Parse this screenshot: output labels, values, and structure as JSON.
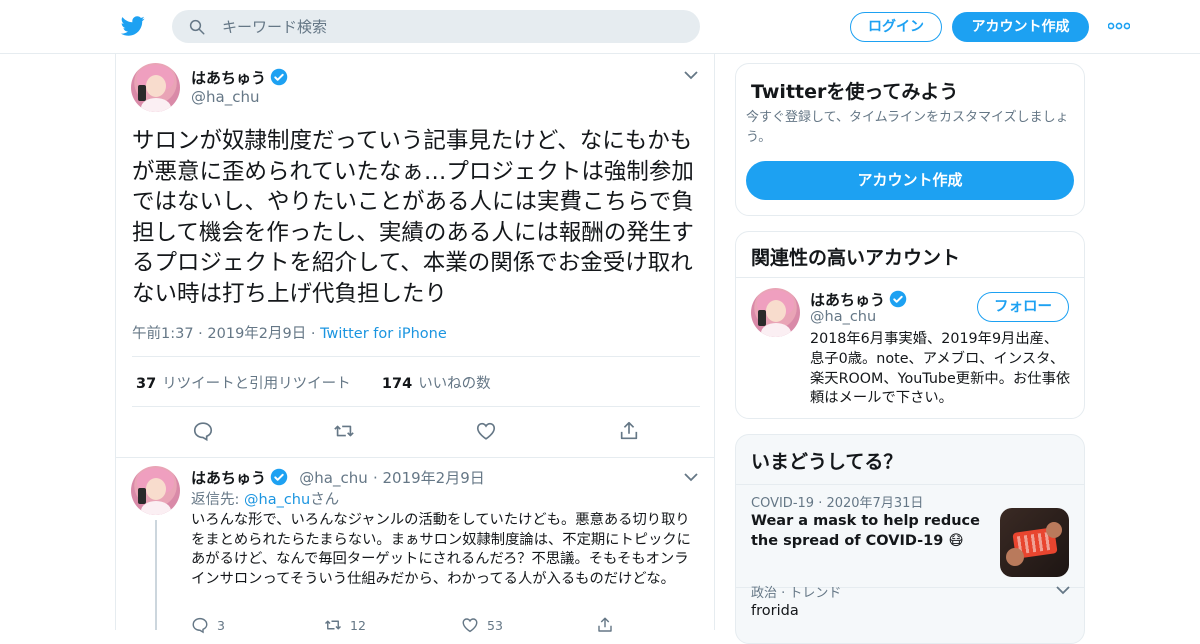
{
  "header": {
    "search_placeholder": "キーワード検索",
    "login_label": "ログイン",
    "signup_label": "アカウント作成"
  },
  "tweet": {
    "name": "はあちゅう",
    "handle": "@ha_chu",
    "text": "サロンが奴隷制度だっていう記事見たけど、なにもかもが悪意に歪められていたなぁ…プロジェクトは強制参加ではないし、やりたいことがある人には実費こちらで負担して機会を作ったし、実績のある人には報酬の発生するプロジェクトを紹介して、本業の関係でお金受け取れない時は打ち上げ代負担したり",
    "time": "午前1:37",
    "date": "2019年2月9日",
    "source": "Twitter for iPhone",
    "retweet_count": "37",
    "retweet_label": "リツイートと引用リツイート",
    "like_count": "174",
    "like_label": "いいねの数"
  },
  "reply": {
    "name": "はあちゅう",
    "handle": "@ha_chu",
    "date": "2019年2月9日",
    "reply_prefix": "返信先: ",
    "reply_to": "@ha_chu",
    "reply_suffix": "さん",
    "text": "いろんな形で、いろんなジャンルの活動をしていたけども。悪意ある切り取りをまとめられたらたまらない。まぁサロン奴隷制度論は、不定期にトピックにあがるけど、なんで毎回ターゲットにされるんだろ？不思議。そもそもオンラインサロンってそういう仕組みだから、わかってる人が入るものだけどな。",
    "reply_count": "3",
    "retweet_count": "12",
    "like_count": "53"
  },
  "sidebar": {
    "try_title": "Twitterを使ってみよう",
    "try_subtitle": "今すぐ登録して、タイムラインをカスタマイズしましょう。",
    "try_button": "アカウント作成",
    "related_title": "関連性の高いアカウント",
    "related_name": "はあちゅう",
    "related_handle": "@ha_chu",
    "follow_label": "フォロー",
    "related_bio": "2018年6月事実婚、2019年9月出産、息子0歳。note、アメブロ、インスタ、 楽天ROOM、YouTube更新中。お仕事依頼はメールで下さい。",
    "trends_title": "いまどうしてる？",
    "trend1_category": "COVID-19",
    "trend1_date": "2020年7月31日",
    "trend1_title": "Wear a mask to help reduce the spread of COVID-19 😷",
    "trend2_category": "政治 · トレンド",
    "trend2_title": "frorida"
  },
  "colors": {
    "accent": "#1da1f2",
    "link": "#1b95e0",
    "muted": "#657786",
    "border": "#e6ecf0"
  },
  "icons": [
    "twitter-bird-icon",
    "search-icon",
    "more-icon",
    "verified-icon",
    "chevron-down-icon",
    "reply-icon",
    "retweet-icon",
    "like-icon",
    "share-icon"
  ]
}
